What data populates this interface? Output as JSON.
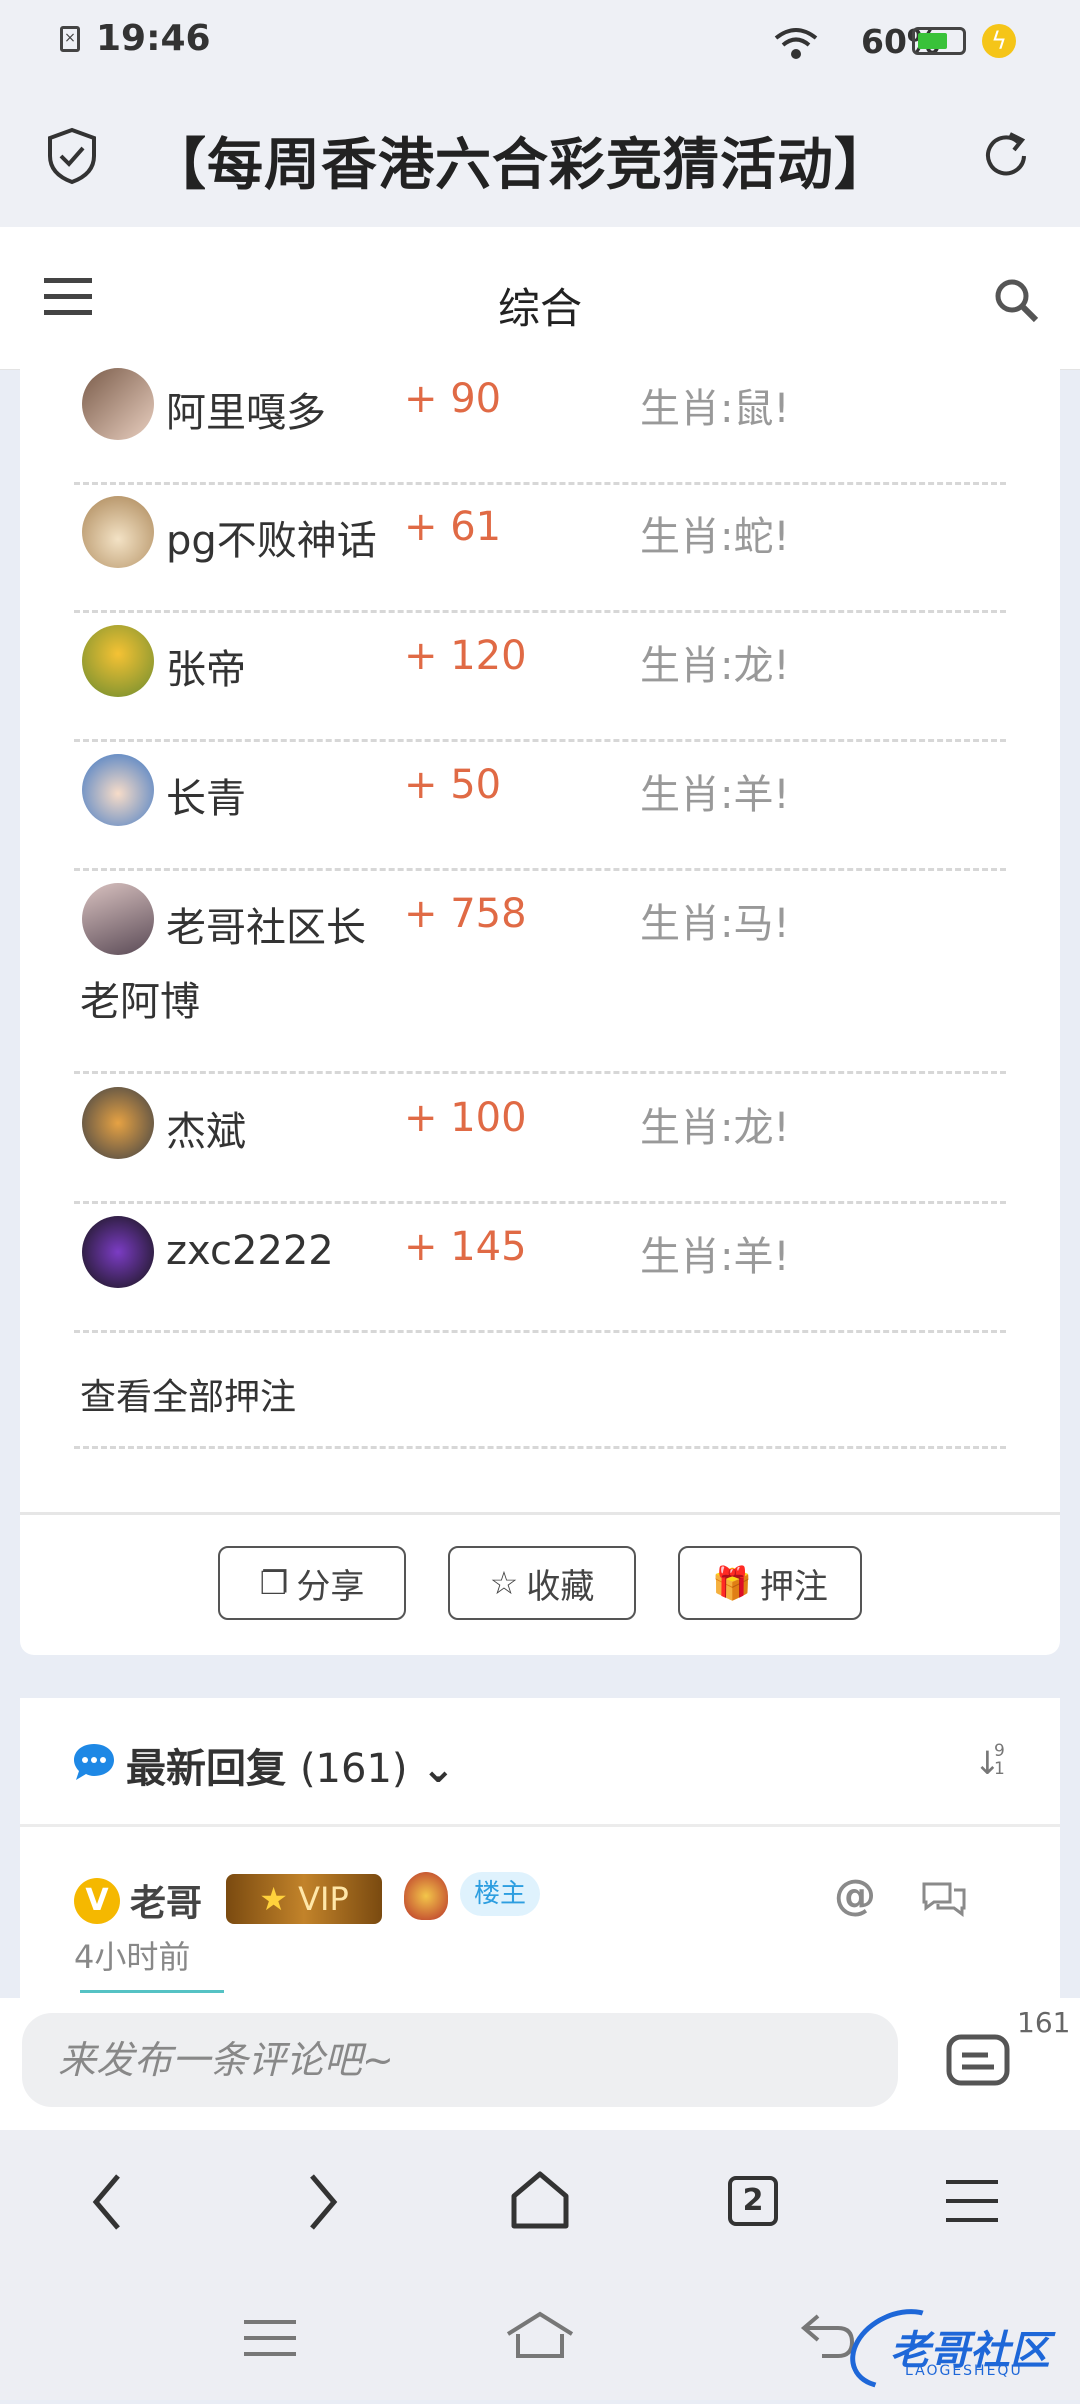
{
  "status": {
    "time": "19:46",
    "battery": "60%"
  },
  "header": {
    "title": "【每周香港六合彩竞猜活动】"
  },
  "nav": {
    "title": "综合"
  },
  "bets": [
    {
      "user": "阿里嘎多",
      "points": "+ 90",
      "zodiac": "生肖:鼠!"
    },
    {
      "user": "pg不败神话",
      "points": "+ 61",
      "zodiac": "生肖:蛇!"
    },
    {
      "user": "张帝",
      "points": "+ 120",
      "zodiac": "生肖:龙!"
    },
    {
      "user": "长青",
      "points": "+ 50",
      "zodiac": "生肖:羊!"
    },
    {
      "user": "老哥社区长",
      "user_cont": "老阿博",
      "points": "+ 758",
      "zodiac": "生肖:马!"
    },
    {
      "user": "杰斌",
      "points": "+ 100",
      "zodiac": "生肖:龙!"
    },
    {
      "user": "zxc2222",
      "points": "+ 145",
      "zodiac": "生肖:羊!"
    }
  ],
  "view_all": "查看全部押注",
  "actions": {
    "share": "分享",
    "favorite": "收藏",
    "bet": "押注"
  },
  "replies": {
    "title": "最新回复",
    "count": "(161)",
    "sort_digits": "9\n1",
    "first": {
      "user": "老哥",
      "vip": "VIP",
      "owner": "楼主",
      "time": "4小时前"
    }
  },
  "comment": {
    "placeholder": "来发布一条评论吧~",
    "count": "161"
  },
  "browser": {
    "tabs": "2"
  },
  "watermark": {
    "text": "老哥社区",
    "sub": "LAOGESHEQU"
  },
  "colors": {
    "points": "#e06a45",
    "owner_badge": "#2d9ee0",
    "accent_blue": "#1e88e5"
  }
}
